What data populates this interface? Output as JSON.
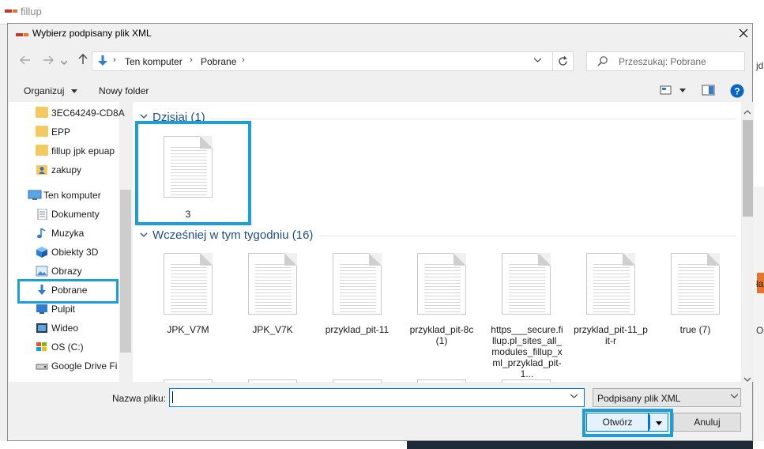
{
  "app": {
    "title": "fillup",
    "logo_text": "FILL•UP",
    "frag_top": "jd",
    "frag_mid": "ła",
    "frag_low": "OS"
  },
  "dialog": {
    "title": "Wybierz podpisany plik XML",
    "icon_text": "FILL•UP"
  },
  "address": {
    "crumbs": [
      "Ten komputer",
      "Pobrane"
    ]
  },
  "search": {
    "placeholder": "Przeszukaj: Pobrane"
  },
  "toolbar": {
    "organize": "Organizuj",
    "new_folder": "Nowy folder"
  },
  "nav": {
    "items": [
      {
        "label": "3EC64249-CD8A",
        "icon": "folder-icon"
      },
      {
        "label": "EPP",
        "icon": "folder-icon"
      },
      {
        "label": "fillup jpk epuap",
        "icon": "folder-icon"
      },
      {
        "label": "zakupy",
        "icon": "contact-folder-icon"
      },
      {
        "label": "Ten komputer",
        "icon": "computer-icon"
      },
      {
        "label": "Dokumenty",
        "icon": "documents-icon"
      },
      {
        "label": "Muzyka",
        "icon": "music-icon"
      },
      {
        "label": "Obiekty 3D",
        "icon": "3d-objects-icon"
      },
      {
        "label": "Obrazy",
        "icon": "pictures-icon"
      },
      {
        "label": "Pobrane",
        "icon": "download-icon"
      },
      {
        "label": "Pulpit",
        "icon": "desktop-icon"
      },
      {
        "label": "Wideo",
        "icon": "video-icon"
      },
      {
        "label": "OS (C:)",
        "icon": "drive-icon"
      },
      {
        "label": "Google Drive File",
        "icon": "drive-icon"
      }
    ]
  },
  "groups": {
    "today": {
      "label": "Dzisiaj (1)",
      "files": [
        "3"
      ]
    },
    "week": {
      "label": "Wcześniej w tym tygodniu (16)",
      "files": [
        "JPK_V7M",
        "JPK_V7K",
        "przyklad_pit-11",
        "przyklad_pit-8c (1)",
        "https___secure.fillup.pl_sites_all_modules_fillup_xml_przyklad_pit-1...",
        "przyklad_pit-11_pit-r",
        "true (7)"
      ]
    }
  },
  "bottom": {
    "filename_label": "Nazwa pliku:",
    "filename_value": "",
    "filter_value": "Podpisany plik XML",
    "open_label": "Otwórz",
    "cancel_label": "Anuluj"
  },
  "colors": {
    "highlight": "#1a9fdc",
    "group_header": "#1e4e8c",
    "accent": "#0078d7"
  }
}
